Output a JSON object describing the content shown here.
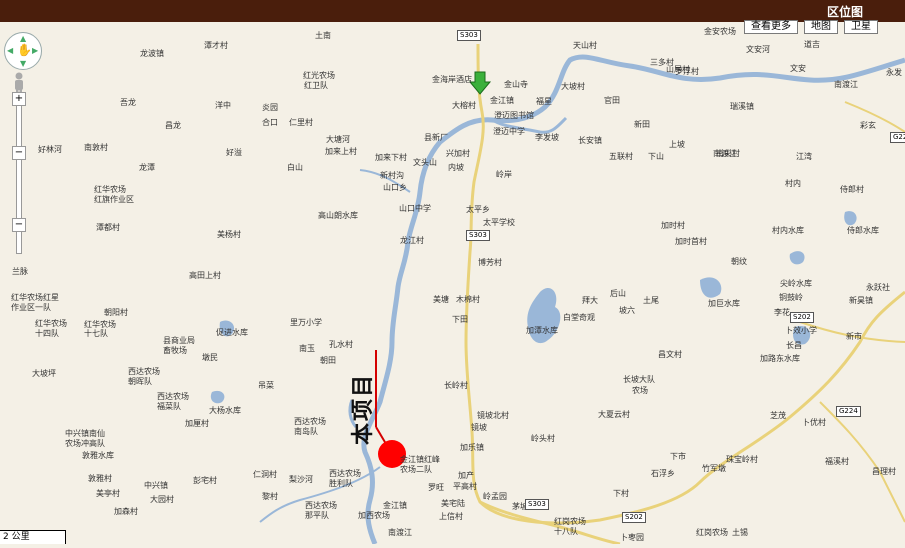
{
  "header": {
    "title": "区位图"
  },
  "map_controls": {
    "buttons": [
      "查看更多",
      "地图",
      "卫星"
    ],
    "scale_label": "2 公里"
  },
  "project": {
    "label": "本项目"
  },
  "map_labels": [
    {
      "text": "土南"
    },
    {
      "text": "龙波镇"
    },
    {
      "text": "潭才村"
    },
    {
      "text": "红光农场"
    },
    {
      "text": "红卫队"
    },
    {
      "text": "吾龙"
    },
    {
      "text": "洋中"
    },
    {
      "text": "炎园"
    },
    {
      "text": "合口"
    },
    {
      "text": "仁里村"
    },
    {
      "text": "昌龙"
    },
    {
      "text": "大塘河"
    },
    {
      "text": "加来上村"
    },
    {
      "text": "加来下村"
    },
    {
      "text": "好林河"
    },
    {
      "text": "南敦村"
    },
    {
      "text": "好溢"
    },
    {
      "text": "白山"
    },
    {
      "text": "龙潭"
    },
    {
      "text": "红华农场"
    },
    {
      "text": "红旗作业区"
    },
    {
      "text": "潭都村"
    },
    {
      "text": "美杨村"
    },
    {
      "text": "高山朗水库"
    },
    {
      "text": "山口乡"
    },
    {
      "text": "山口中学"
    },
    {
      "text": "新村沟"
    },
    {
      "text": "文头山"
    },
    {
      "text": "兴加村"
    },
    {
      "text": "内坡"
    },
    {
      "text": "龙江村"
    },
    {
      "text": "兰脉"
    },
    {
      "text": "高田上村"
    },
    {
      "text": "红华农场红星"
    },
    {
      "text": "作业区一队"
    },
    {
      "text": "朝阳村"
    },
    {
      "text": "红华农场"
    },
    {
      "text": "十七队"
    },
    {
      "text": "红华农场"
    },
    {
      "text": "十四队"
    },
    {
      "text": "县商业局"
    },
    {
      "text": "畜牧场"
    },
    {
      "text": "促进水库"
    },
    {
      "text": "里万小学"
    },
    {
      "text": "孔水村"
    },
    {
      "text": "南玉"
    },
    {
      "text": "朝田"
    },
    {
      "text": "墩民"
    },
    {
      "text": "大坡坪"
    },
    {
      "text": "西达农场"
    },
    {
      "text": "朝晖队"
    },
    {
      "text": "西达农场"
    },
    {
      "text": "福菜队"
    },
    {
      "text": "大杨水库"
    },
    {
      "text": "吊菜"
    },
    {
      "text": "西达农场"
    },
    {
      "text": "南岛队"
    },
    {
      "text": "加厘村"
    },
    {
      "text": "中兴镇南仙"
    },
    {
      "text": "农场冲高队"
    },
    {
      "text": "敦雅水库"
    },
    {
      "text": "敦雅村"
    },
    {
      "text": "彭宅村"
    },
    {
      "text": "中兴镇"
    },
    {
      "text": "仁洞村"
    },
    {
      "text": "梨沙河"
    },
    {
      "text": "美亭村"
    },
    {
      "text": "大园村"
    },
    {
      "text": "黎村"
    },
    {
      "text": "西达农场"
    },
    {
      "text": "胜利队"
    },
    {
      "text": "西达农场"
    },
    {
      "text": "那平队"
    },
    {
      "text": "加森村"
    },
    {
      "text": "金江镇红峰"
    },
    {
      "text": "农场二队"
    },
    {
      "text": "金江镇"
    },
    {
      "text": "加西农场"
    },
    {
      "text": "南渡江"
    },
    {
      "text": "罗旺"
    },
    {
      "text": "平高村"
    },
    {
      "text": "加产"
    },
    {
      "text": "美宅陆"
    },
    {
      "text": "上信村"
    },
    {
      "text": "岭孟园"
    },
    {
      "text": "茅坡村"
    },
    {
      "text": "加乐镇"
    },
    {
      "text": "岭头村"
    },
    {
      "text": "镜坡北村"
    },
    {
      "text": "镜坡"
    },
    {
      "text": "长岭村"
    },
    {
      "text": "下田"
    },
    {
      "text": "美塘"
    },
    {
      "text": "木棉村"
    },
    {
      "text": "博芳村"
    },
    {
      "text": "太平乡"
    },
    {
      "text": "太平学校"
    },
    {
      "text": "岭岸"
    },
    {
      "text": "金江镇"
    },
    {
      "text": "大榕村"
    },
    {
      "text": "金山寺"
    },
    {
      "text": "金海岸酒店"
    },
    {
      "text": "澄迈图书馆"
    },
    {
      "text": "澄迈中学"
    },
    {
      "text": "县新厂"
    },
    {
      "text": "李发坡"
    },
    {
      "text": "长安镇"
    },
    {
      "text": "大坡村"
    },
    {
      "text": "福星"
    },
    {
      "text": "官田"
    },
    {
      "text": "新田"
    },
    {
      "text": "五联村"
    },
    {
      "text": "下山"
    },
    {
      "text": "上坡"
    },
    {
      "text": "南渡江"
    },
    {
      "text": "天山村"
    },
    {
      "text": "三多村"
    },
    {
      "text": "金安农场"
    },
    {
      "text": "山尾村"
    },
    {
      "text": "罗浮村"
    },
    {
      "text": "文安河"
    },
    {
      "text": "道吉"
    },
    {
      "text": "瑞溪镇"
    },
    {
      "text": "南渡江"
    },
    {
      "text": "永发"
    },
    {
      "text": "文安"
    },
    {
      "text": "彩玄"
    },
    {
      "text": "南尖村"
    },
    {
      "text": "江湾"
    },
    {
      "text": "村内"
    },
    {
      "text": "侍郎村"
    },
    {
      "text": "加时村"
    },
    {
      "text": "加时首村"
    },
    {
      "text": "村内水库"
    },
    {
      "text": "侍郎水库"
    },
    {
      "text": "朝纹"
    },
    {
      "text": "后山"
    },
    {
      "text": "拜大"
    },
    {
      "text": "土尾"
    },
    {
      "text": "坡六"
    },
    {
      "text": "白堂奇观"
    },
    {
      "text": "加潭水库"
    },
    {
      "text": "尖岭水库"
    },
    {
      "text": "铜鼓岭"
    },
    {
      "text": "永跃社"
    },
    {
      "text": "加巨水库"
    },
    {
      "text": "新昊镇"
    },
    {
      "text": "李花"
    },
    {
      "text": "卜效小学"
    },
    {
      "text": "新市"
    },
    {
      "text": "加路东水库"
    },
    {
      "text": "长昌"
    },
    {
      "text": "昌文村"
    },
    {
      "text": "长坡大队"
    },
    {
      "text": "农场"
    },
    {
      "text": "大夏云村"
    },
    {
      "text": "芝茂"
    },
    {
      "text": "卜优村"
    },
    {
      "text": "下市"
    },
    {
      "text": "珠宝岭村"
    },
    {
      "text": "竹军墩"
    },
    {
      "text": "石浮乡"
    },
    {
      "text": "福溪村"
    },
    {
      "text": "昌理村"
    },
    {
      "text": "红岗农场"
    },
    {
      "text": "十八队"
    },
    {
      "text": "下村"
    },
    {
      "text": "红岗农场"
    },
    {
      "text": "土锡"
    },
    {
      "text": "卜枣园"
    }
  ],
  "road_labels": [
    "S303",
    "S303",
    "S303",
    "G224",
    "S202",
    "S202",
    "G224"
  ]
}
